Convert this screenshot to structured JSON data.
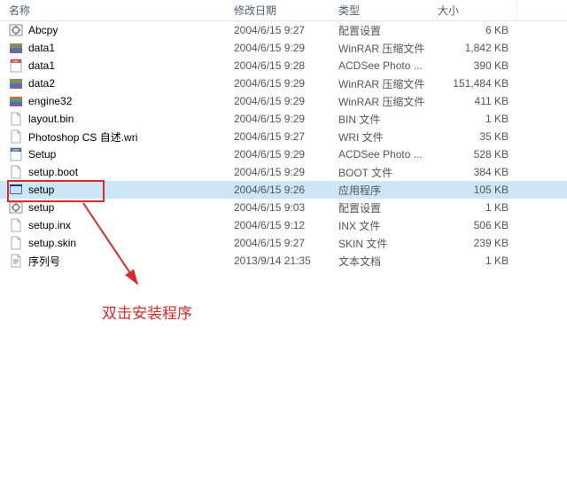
{
  "columns": {
    "name": "名称",
    "date": "修改日期",
    "type": "类型",
    "size": "大小"
  },
  "annotation": "双击安装程序",
  "icons": {
    "config": "config",
    "rar": "rar",
    "anu": "anu",
    "file": "file",
    "bmp": "bmp",
    "exe": "exe",
    "txt": "txt"
  },
  "rows": [
    {
      "icon": "config",
      "name": "Abcpy",
      "date": "2004/6/15 9:27",
      "type": "配置设置",
      "size": "6 KB",
      "selected": false
    },
    {
      "icon": "rar",
      "name": "data1",
      "date": "2004/6/15 9:29",
      "type": "WinRAR 压缩文件",
      "size": "1,842 KB",
      "selected": false
    },
    {
      "icon": "anu",
      "name": "data1",
      "date": "2004/6/15 9:28",
      "type": "ACDSee Photo ...",
      "size": "390 KB",
      "selected": false
    },
    {
      "icon": "rar",
      "name": "data2",
      "date": "2004/6/15 9:29",
      "type": "WinRAR 压缩文件",
      "size": "151,484 KB",
      "selected": false
    },
    {
      "icon": "rar",
      "name": "engine32",
      "date": "2004/6/15 9:29",
      "type": "WinRAR 压缩文件",
      "size": "411 KB",
      "selected": false
    },
    {
      "icon": "file",
      "name": "layout.bin",
      "date": "2004/6/15 9:29",
      "type": "BIN 文件",
      "size": "1 KB",
      "selected": false
    },
    {
      "icon": "file",
      "name": "Photoshop CS 自述.wri",
      "date": "2004/6/15 9:27",
      "type": "WRI 文件",
      "size": "35 KB",
      "selected": false
    },
    {
      "icon": "bmp",
      "name": "Setup",
      "date": "2004/6/15 9:29",
      "type": "ACDSee Photo ...",
      "size": "528 KB",
      "selected": false
    },
    {
      "icon": "file",
      "name": "setup.boot",
      "date": "2004/6/15 9:29",
      "type": "BOOT 文件",
      "size": "384 KB",
      "selected": false
    },
    {
      "icon": "exe",
      "name": "setup",
      "date": "2004/6/15 9:26",
      "type": "应用程序",
      "size": "105 KB",
      "selected": true
    },
    {
      "icon": "config",
      "name": "setup",
      "date": "2004/6/15 9:03",
      "type": "配置设置",
      "size": "1 KB",
      "selected": false
    },
    {
      "icon": "file",
      "name": "setup.inx",
      "date": "2004/6/15 9:12",
      "type": "INX 文件",
      "size": "506 KB",
      "selected": false
    },
    {
      "icon": "file",
      "name": "setup.skin",
      "date": "2004/6/15 9:27",
      "type": "SKIN 文件",
      "size": "239 KB",
      "selected": false
    },
    {
      "icon": "txt",
      "name": "序列号",
      "date": "2013/9/14 21:35",
      "type": "文本文档",
      "size": "1 KB",
      "selected": false
    }
  ]
}
